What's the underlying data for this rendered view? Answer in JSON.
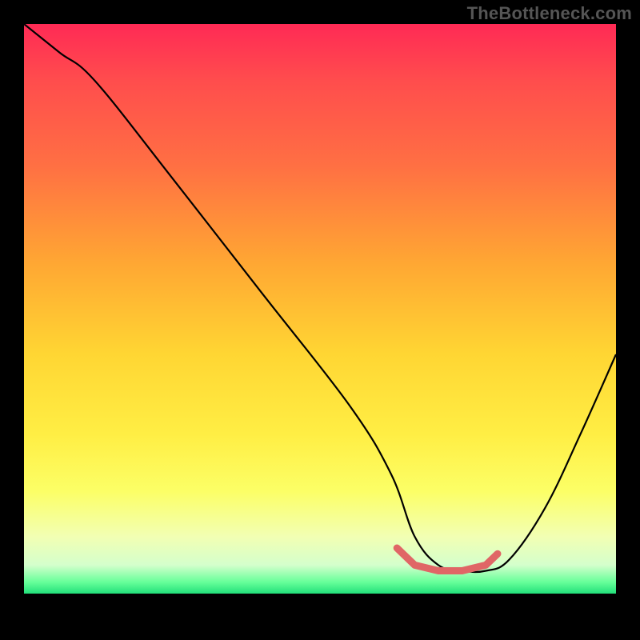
{
  "watermark": "TheBottleneck.com",
  "chart_data": {
    "type": "line",
    "title": "",
    "xlabel": "",
    "ylabel": "",
    "xlim": [
      0,
      100
    ],
    "ylim": [
      0,
      100
    ],
    "series": [
      {
        "name": "bottleneck-curve",
        "x": [
          0,
          6,
          12,
          25,
          40,
          55,
          62,
          66,
          70,
          74,
          78,
          82,
          88,
          94,
          100
        ],
        "y": [
          100,
          95,
          90,
          73,
          53,
          33,
          21,
          10,
          5,
          4,
          4,
          6,
          15,
          28,
          42
        ]
      }
    ],
    "highlight": {
      "name": "optimal-range",
      "x": [
        63,
        66,
        70,
        74,
        78,
        80
      ],
      "y": [
        8,
        5,
        4,
        4,
        5,
        7
      ]
    },
    "gradient_stops": [
      {
        "pos": 0,
        "color": "#ff2a55"
      },
      {
        "pos": 25,
        "color": "#ff7043"
      },
      {
        "pos": 58,
        "color": "#ffd633"
      },
      {
        "pos": 90,
        "color": "#f2ffb3"
      },
      {
        "pos": 100,
        "color": "#22e07a"
      }
    ]
  }
}
